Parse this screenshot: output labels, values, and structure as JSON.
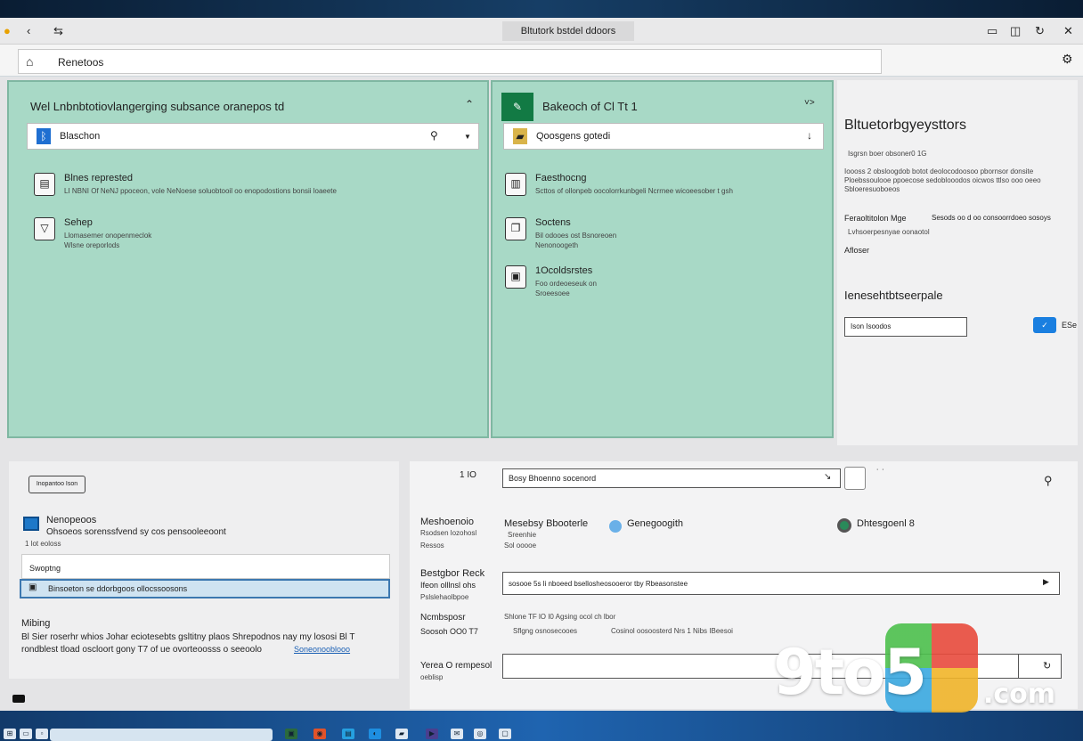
{
  "window": {
    "title": "Bltutork bstdel ddoors",
    "nav_icons": [
      "back-arrow-icon",
      "forward-arrow-icon"
    ],
    "controls": [
      "minimize-icon",
      "restore-icon",
      "close-icon"
    ]
  },
  "address": {
    "value": "Renetoos"
  },
  "panel_left": {
    "title": "Wel Lnbnbtotiovlangerging subsance oranepos td",
    "search_label": "Blaschon",
    "items": [
      {
        "title": "Blnes represted",
        "desc": "LI NBNI Of NeNJ ppoceon, vole NeNoese soluobtooil oo enopodostions bonsii loaeete"
      },
      {
        "title": "Sehep",
        "desc1": "Llomasemer onopenmeclok",
        "desc2": "Wlsne oreporlods"
      }
    ]
  },
  "panel_mid": {
    "title": "Bakeoch of Cl Tt 1",
    "search_label": "Qoosgens gotedi",
    "items": [
      {
        "title": "Faesthocng",
        "desc": "Scttos of ollonpeb oocolorrkunbgeli Ncrrnee wicoeesober t gsh"
      },
      {
        "title": "Soctens",
        "desc1": "Bil odooes ost Bsnoreoen",
        "desc2": "Nenonoogeth"
      },
      {
        "title": "1Ocoldsrstes",
        "desc1": "Foo ordeoeseuk on",
        "desc2": "Sroeesoee"
      }
    ]
  },
  "panel_right": {
    "title": "Bltuetorbgyeysttors",
    "sub": "Isgrsn boer obsoner0 1G",
    "para1": "Ioooss 2 obsloogdob botot deolocodoosoo pbornsor donsite",
    "para2": "Ploebssoulooe ppoecose sedoblooodos oicwos ttlso ooo oeeo",
    "para3": "Sbloeresuoboeos",
    "row_label": "Feraoltitolon Mge",
    "row_value": "Sesods oo d oo consoorrdoeo sosoys",
    "row_sub": "Lvhsoerpesnyae oonaotol",
    "after": "Afloser",
    "heading2": "Ienesehtbtseerpale",
    "input_value": "Ison Isoodos",
    "button_label": "ESe"
  },
  "bottom_left": {
    "tag": "Inopantoo Ison",
    "header": "Nenopeoos",
    "header_desc": "Ohsoeos sorenssfvend sy cos pensooleeoont",
    "header_sub": "1 lot eoloss",
    "list_item_1": "Swoptng",
    "list_item_2": "Binsoeton se ddorbgoos ollocssoosons",
    "section": "Mibing",
    "line1": "Bl Sier roserhr whios Johar eciotesebts gsltitny plaos Shrepodnos nay my lososi Bl T",
    "line2": "rondblest tload oscloort gony T7 of ue ovorteoosss o seeoolo",
    "link": "Soneonooblooo"
  },
  "bottom_right": {
    "top_label": "1 IO",
    "top_input": "Bosy Bhoenno socenord",
    "row1_label": "Meshoenoio",
    "row1_sub1": "Rsodsen lozohosl",
    "row1_sub2": "Ressos",
    "row1_value": "Mesebsy Bbooterle",
    "row1_radio1": "Genegoogith",
    "row1_radio2": "Dhtesgoenl 8",
    "row1_value_sub1": "Sreenhie",
    "row1_value_sub2": "Sol ooooe",
    "row2_label": "Bestgbor Reck",
    "row2_sub1": "Ifeon olllnsl ohs",
    "row2_sub2": "Pslslehaolbpoe",
    "row2_value": "sosooe 5s li nboeed bsellosheosooeror tby Rbeasonstee",
    "row3_label": "Ncmbsposr",
    "row3_sub": "Soosoh OO0 T7",
    "row3_line1": "Shlone TF lO I0 Agsing ocol ch lbor",
    "row3_line2": "Sflgng osnosecooes",
    "row3_line3": "Cosinol oosoosterd Nrs 1 Nibs IBeesoi",
    "row4_label": "Yerea O rempesol",
    "row4_sub": "oeblisp"
  },
  "watermark": {
    "text": "9to5",
    "suffix": ".com"
  }
}
